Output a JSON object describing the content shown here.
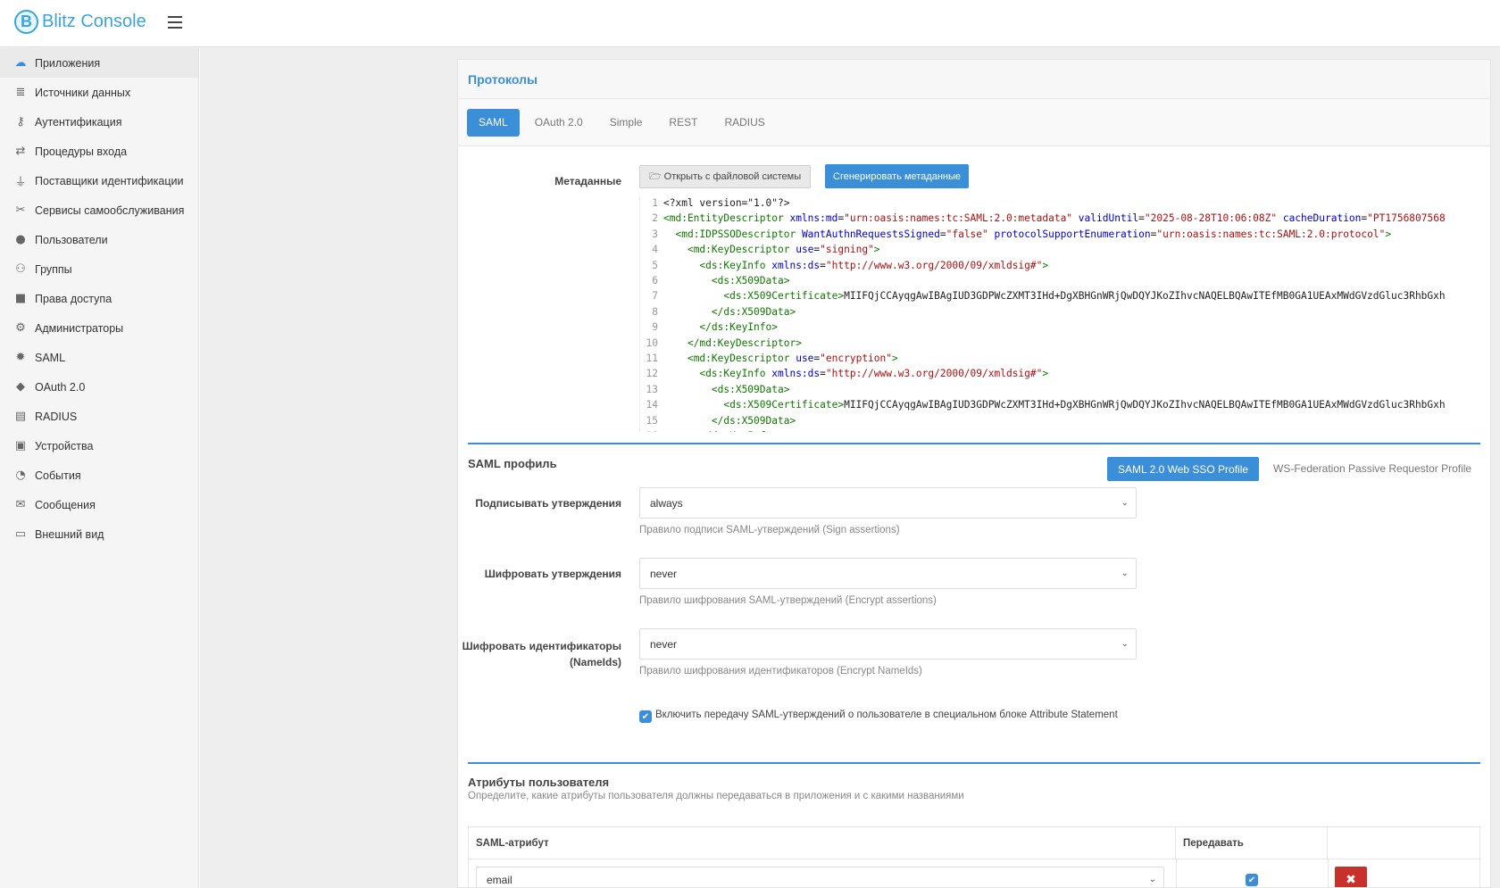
{
  "app": {
    "logo_letter": "B",
    "title": "Blitz Console"
  },
  "sidebar": {
    "items": [
      {
        "label": "Приложения",
        "icon": "cloud-icon",
        "glyph": "☁",
        "active": true
      },
      {
        "label": "Источники данных",
        "icon": "database-icon",
        "glyph": "≣"
      },
      {
        "label": "Аутентификация",
        "icon": "key-icon",
        "glyph": "⚷"
      },
      {
        "label": "Процедуры входа",
        "icon": "retweet-icon",
        "glyph": "⇄"
      },
      {
        "label": "Поставщики идентификации",
        "icon": "plug-icon",
        "glyph": "⏚"
      },
      {
        "label": "Сервисы самообслуживания",
        "icon": "tools-icon",
        "glyph": "✂"
      },
      {
        "label": "Пользователи",
        "icon": "user-icon",
        "glyph": "●"
      },
      {
        "label": "Группы",
        "icon": "users-icon",
        "glyph": "⚇"
      },
      {
        "label": "Права доступа",
        "icon": "lock-icon",
        "glyph": "■"
      },
      {
        "label": "Администраторы",
        "icon": "cogs-icon",
        "glyph": "⚙"
      },
      {
        "label": "SAML",
        "icon": "certificate-icon",
        "glyph": "✹"
      },
      {
        "label": "OAuth 2.0",
        "icon": "tag-icon",
        "glyph": "◆"
      },
      {
        "label": "RADIUS",
        "icon": "radius-icon",
        "glyph": "▤"
      },
      {
        "label": "Устройства",
        "icon": "device-icon",
        "glyph": "▣"
      },
      {
        "label": "События",
        "icon": "dashboard-icon",
        "glyph": "◔"
      },
      {
        "label": "Сообщения",
        "icon": "envelope-icon",
        "glyph": "✉"
      },
      {
        "label": "Внешний вид",
        "icon": "desktop-icon",
        "glyph": "▭"
      }
    ]
  },
  "panel": {
    "title": "Протоколы",
    "tabs": [
      {
        "label": "SAML",
        "active": true
      },
      {
        "label": "OAuth 2.0"
      },
      {
        "label": "Simple"
      },
      {
        "label": "REST"
      },
      {
        "label": "RADIUS"
      }
    ]
  },
  "metadata": {
    "label": "Метаданные",
    "open_button": "Открыть с файловой системы",
    "generate_button": "Сгенерировать метаданные",
    "lines": [
      [
        [
          "t-plain",
          "<?xml version=\"1.0\"?>"
        ]
      ],
      [
        [
          "t-tag",
          "<md:EntityDescriptor "
        ],
        [
          "t-attr",
          "xmlns:md"
        ],
        [
          "t-plain",
          "="
        ],
        [
          "t-val",
          "\"urn:oasis:names:tc:SAML:2.0:metadata\""
        ],
        [
          "t-plain",
          " "
        ],
        [
          "t-attr",
          "validUntil"
        ],
        [
          "t-plain",
          "="
        ],
        [
          "t-val",
          "\"2025-08-28T10:06:08Z\""
        ],
        [
          "t-plain",
          " "
        ],
        [
          "t-attr",
          "cacheDuration"
        ],
        [
          "t-plain",
          "="
        ],
        [
          "t-val",
          "\"PT1756807568"
        ]
      ],
      [
        [
          "t-plain",
          "  "
        ],
        [
          "t-tag",
          "<md:IDPSSODescriptor "
        ],
        [
          "t-attr",
          "WantAuthnRequestsSigned"
        ],
        [
          "t-plain",
          "="
        ],
        [
          "t-val",
          "\"false\""
        ],
        [
          "t-plain",
          " "
        ],
        [
          "t-attr",
          "protocolSupportEnumeration"
        ],
        [
          "t-plain",
          "="
        ],
        [
          "t-val",
          "\"urn:oasis:names:tc:SAML:2.0:protocol\""
        ],
        [
          "t-tag",
          ">"
        ]
      ],
      [
        [
          "t-plain",
          "    "
        ],
        [
          "t-tag",
          "<md:KeyDescriptor "
        ],
        [
          "t-attr",
          "use"
        ],
        [
          "t-plain",
          "="
        ],
        [
          "t-val",
          "\"signing\""
        ],
        [
          "t-tag",
          ">"
        ]
      ],
      [
        [
          "t-plain",
          "      "
        ],
        [
          "t-tag",
          "<ds:KeyInfo "
        ],
        [
          "t-attr",
          "xmlns:ds"
        ],
        [
          "t-plain",
          "="
        ],
        [
          "t-val",
          "\"http://www.w3.org/2000/09/xmldsig#\""
        ],
        [
          "t-tag",
          ">"
        ]
      ],
      [
        [
          "t-plain",
          "        "
        ],
        [
          "t-tag",
          "<ds:X509Data>"
        ]
      ],
      [
        [
          "t-plain",
          "          "
        ],
        [
          "t-tag",
          "<ds:X509Certificate>"
        ],
        [
          "t-plain",
          "MIIFQjCCAyqgAwIBAgIUD3GDPWcZXMT3IHd+DgXBHGnWRjQwDQYJKoZIhvcNAQELBQAwITEfMB0GA1UEAxMWdGVzdGluc3RhbGxh"
        ]
      ],
      [
        [
          "t-plain",
          "        "
        ],
        [
          "t-tag",
          "</ds:X509Data>"
        ]
      ],
      [
        [
          "t-plain",
          "      "
        ],
        [
          "t-tag",
          "</ds:KeyInfo>"
        ]
      ],
      [
        [
          "t-plain",
          "    "
        ],
        [
          "t-tag",
          "</md:KeyDescriptor>"
        ]
      ],
      [
        [
          "t-plain",
          "    "
        ],
        [
          "t-tag",
          "<md:KeyDescriptor "
        ],
        [
          "t-attr",
          "use"
        ],
        [
          "t-plain",
          "="
        ],
        [
          "t-val",
          "\"encryption\""
        ],
        [
          "t-tag",
          ">"
        ]
      ],
      [
        [
          "t-plain",
          "      "
        ],
        [
          "t-tag",
          "<ds:KeyInfo "
        ],
        [
          "t-attr",
          "xmlns:ds"
        ],
        [
          "t-plain",
          "="
        ],
        [
          "t-val",
          "\"http://www.w3.org/2000/09/xmldsig#\""
        ],
        [
          "t-tag",
          ">"
        ]
      ],
      [
        [
          "t-plain",
          "        "
        ],
        [
          "t-tag",
          "<ds:X509Data>"
        ]
      ],
      [
        [
          "t-plain",
          "          "
        ],
        [
          "t-tag",
          "<ds:X509Certificate>"
        ],
        [
          "t-plain",
          "MIIFQjCCAyqgAwIBAgIUD3GDPWcZXMT3IHd+DgXBHGnWRjQwDQYJKoZIhvcNAQELBQAwITEfMB0GA1UEAxMWdGVzdGluc3RhbGxh"
        ]
      ],
      [
        [
          "t-plain",
          "        "
        ],
        [
          "t-tag",
          "</ds:X509Data>"
        ]
      ],
      [
        [
          "t-plain",
          "      "
        ],
        [
          "t-tag",
          "</ds:KeyInfo>"
        ]
      ]
    ]
  },
  "saml_profile": {
    "title": "SAML профиль",
    "profile_active": "SAML 2.0 Web SSO Profile",
    "profile_other": "WS-Federation Passive Requestor Profile",
    "sign": {
      "label": "Подписывать утверждения",
      "value": "always",
      "help": "Правило подписи SAML-утверждений (Sign assertions)"
    },
    "encrypt": {
      "label": "Шифровать утверждения",
      "value": "never",
      "help": "Правило шифрования SAML-утверждений (Encrypt assertions)"
    },
    "encrypt_ids": {
      "label_line1": "Шифровать идентификаторы",
      "label_line2": "(NameIds)",
      "value": "never",
      "help": "Правило шифрования идентификаторов (Encrypt NameIds)"
    },
    "attr_statement": {
      "checked": true,
      "label": "Включить передачу SAML-утверждений о пользователе в специальном блоке Attribute Statement"
    }
  },
  "user_attributes": {
    "title": "Атрибуты пользователя",
    "subtitle": "Определите, какие атрибуты пользователя должны передаваться в приложения и с какими названиями",
    "columns": {
      "attribute": "SAML-атрибут",
      "transmit": "Передавать"
    },
    "rows": [
      {
        "attribute": "email",
        "transmit": true
      }
    ]
  },
  "colors": {
    "accent": "#3a8fd8",
    "logo": "#3ba5d8",
    "danger": "#c9302c"
  }
}
